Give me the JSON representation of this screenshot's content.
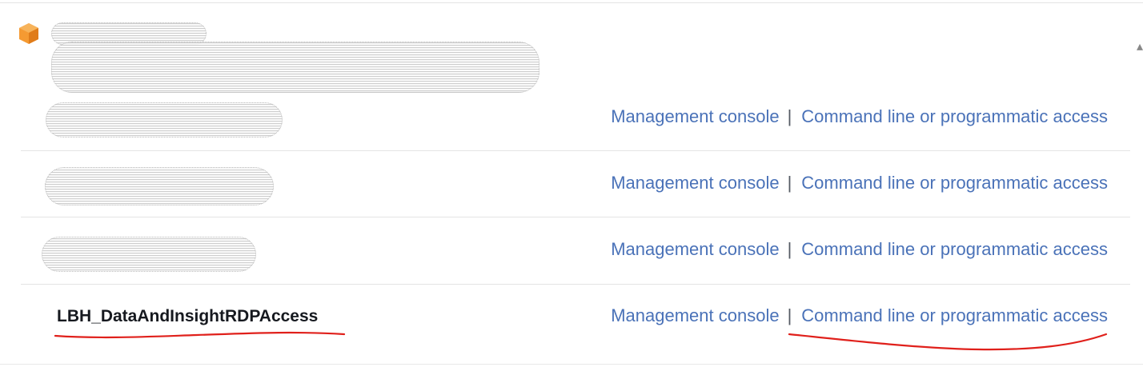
{
  "account": {
    "icon": "aws-account-cube-icon",
    "icon_color": "#ec8b2c",
    "name_redacted": true
  },
  "rows": [
    {
      "role_name": "",
      "redacted": true,
      "console_link": "Management console",
      "separator": "|",
      "cli_link": "Command line or programmatic access"
    },
    {
      "role_name": "",
      "redacted": true,
      "console_link": "Management console",
      "separator": "|",
      "cli_link": "Command line or programmatic access"
    },
    {
      "role_name": "",
      "redacted": true,
      "console_link": "Management console",
      "separator": "|",
      "cli_link": "Command line or programmatic access"
    },
    {
      "role_name": "LBH_DataAndInsightRDPAccess",
      "redacted": false,
      "console_link": "Management console",
      "separator": "|",
      "cli_link": "Command line or programmatic access"
    }
  ],
  "colors": {
    "link": "#4a72b8",
    "annotation": "#e0201b",
    "divider": "#e4e4e4"
  }
}
